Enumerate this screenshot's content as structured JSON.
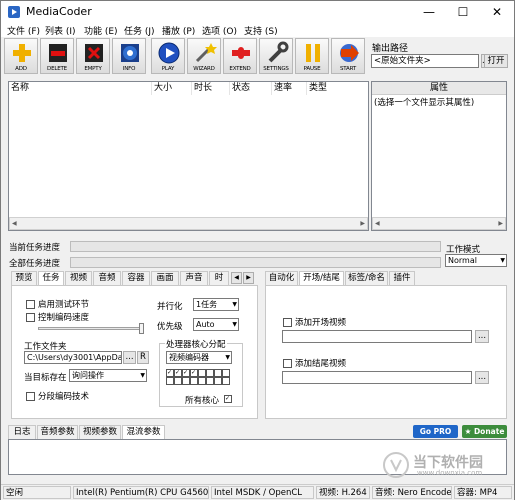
{
  "window": {
    "title": "MediaCoder"
  },
  "menu": [
    "文件 (F)",
    "列表 (I)",
    "功能 (E)",
    "任务 (J)",
    "播放 (P)",
    "选项 (O)",
    "支持 (S)"
  ],
  "toolbar": {
    "buttons": [
      {
        "label": "ADD",
        "icon": "add-icon",
        "color": "#f0b000"
      },
      {
        "label": "DELETE",
        "icon": "delete-icon",
        "color": "#d01010"
      },
      {
        "label": "EMPTY",
        "icon": "empty-icon",
        "color": "#c01818"
      },
      {
        "label": "INFO",
        "icon": "info-icon",
        "color": "#2f6fd0"
      },
      {
        "label": "PLAY",
        "icon": "play-icon",
        "color": "#2050c0"
      },
      {
        "label": "WIZARD",
        "icon": "wizard-icon",
        "color": "#808080"
      },
      {
        "label": "EXTEND",
        "icon": "extend-icon",
        "color": "#e02020"
      },
      {
        "label": "SETTINGS",
        "icon": "settings-icon",
        "color": "#404040"
      },
      {
        "label": "PAUSE",
        "icon": "pause-icon",
        "color": "#f0b000"
      },
      {
        "label": "START",
        "icon": "start-icon",
        "color": "#e04000"
      }
    ]
  },
  "output": {
    "label": "输出路径",
    "value": "<原始文件夹>",
    "browse_label": "...",
    "open_label": "打开"
  },
  "file_list": {
    "columns": [
      "名称",
      "大小",
      "时长",
      "状态",
      "速率",
      "类型"
    ]
  },
  "properties": {
    "header": "属性",
    "hint": "(选择一个文件显示其属性)"
  },
  "progress": {
    "current_label": "当前任务进度",
    "total_label": "全部任务进度"
  },
  "work_mode": {
    "label": "工作模式",
    "value": "Normal"
  },
  "left_tabs": [
    "预览",
    "任务",
    "视频",
    "音频",
    "容器",
    "画面",
    "声音",
    "时"
  ],
  "left_tab_selected": "任务",
  "task_panel": {
    "enable_test": "启用测试环节",
    "rate_control": "控制编码速度",
    "parallel_label": "并行化",
    "parallel_value": "1任务",
    "priority_label": "优先级",
    "priority_value": "Auto",
    "workdir_label": "工作文件夹",
    "workdir_value": "C:\\Users\\dy3001\\AppData\\",
    "workdir_browse": "...",
    "workdir_r": "R",
    "exists_label": "当目标存在",
    "exists_value": "询问操作",
    "segment_encoding": "分段编码技术",
    "cpu_group_title": "处理器核心分配",
    "cpu_select_value": "视频编码器",
    "all_cores_label": "所有核心"
  },
  "right_tabs": [
    "自动化",
    "开场/结尾",
    "标签/命名",
    "插件"
  ],
  "right_tab_selected": "开场/结尾",
  "intro_panel": {
    "add_intro": "添加开场视频",
    "add_outro": "添加结尾视频",
    "browse": "..."
  },
  "bottom_tabs": [
    "日志",
    "音频参数",
    "视频参数",
    "混流参数"
  ],
  "bottom_tab_selected": "混流参数",
  "badges": {
    "go_pro": "Go PRO",
    "donate": "Donate"
  },
  "statusbar": {
    "state": "空闲",
    "cpu": "Intel(R) Pentium(R) CPU G4560",
    "gpu": "Intel MSDK / OpenCL",
    "video": "视频: H.264",
    "audio": "音频: Nero Encoder",
    "container": "容器: MP4"
  },
  "watermark": {
    "text": "当下软件园",
    "sub": "www.downxia.com"
  }
}
